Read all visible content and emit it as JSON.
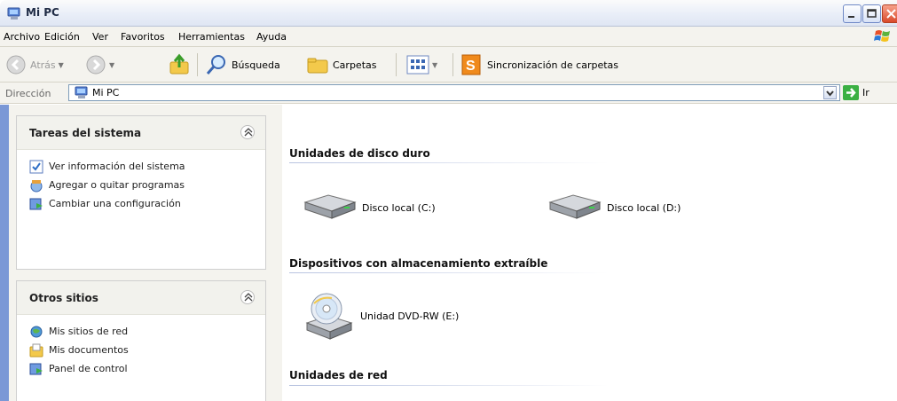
{
  "window": {
    "title": "Mi PC"
  },
  "menu": [
    "Archivo",
    "Edición",
    "Ver",
    "Favoritos",
    "Herramientas",
    "Ayuda"
  ],
  "toolbar": {
    "back_label": "Atrás",
    "search_label": "Búsqueda",
    "folders_label": "Carpetas",
    "sync_label": "Sincronización de carpetas"
  },
  "address": {
    "label": "Dirección",
    "value": "Mi PC",
    "go_label": "Ir"
  },
  "sidebar": {
    "system_tasks": {
      "title": "Tareas del sistema",
      "items": [
        "Ver información del sistema",
        "Agregar o quitar programas",
        "Cambiar una configuración"
      ]
    },
    "other_places": {
      "title": "Otros sitios",
      "items": [
        "Mis sitios de red",
        "Mis documentos",
        "Panel de control"
      ]
    }
  },
  "content": {
    "hard_drives": {
      "title": "Unidades de disco duro",
      "items": [
        "Disco local (C:)",
        "Disco local (D:)"
      ]
    },
    "removable": {
      "title": "Dispositivos con almacenamiento extraíble",
      "items": [
        "Unidad DVD-RW (E:)"
      ]
    },
    "network": {
      "title": "Unidades de red"
    }
  }
}
